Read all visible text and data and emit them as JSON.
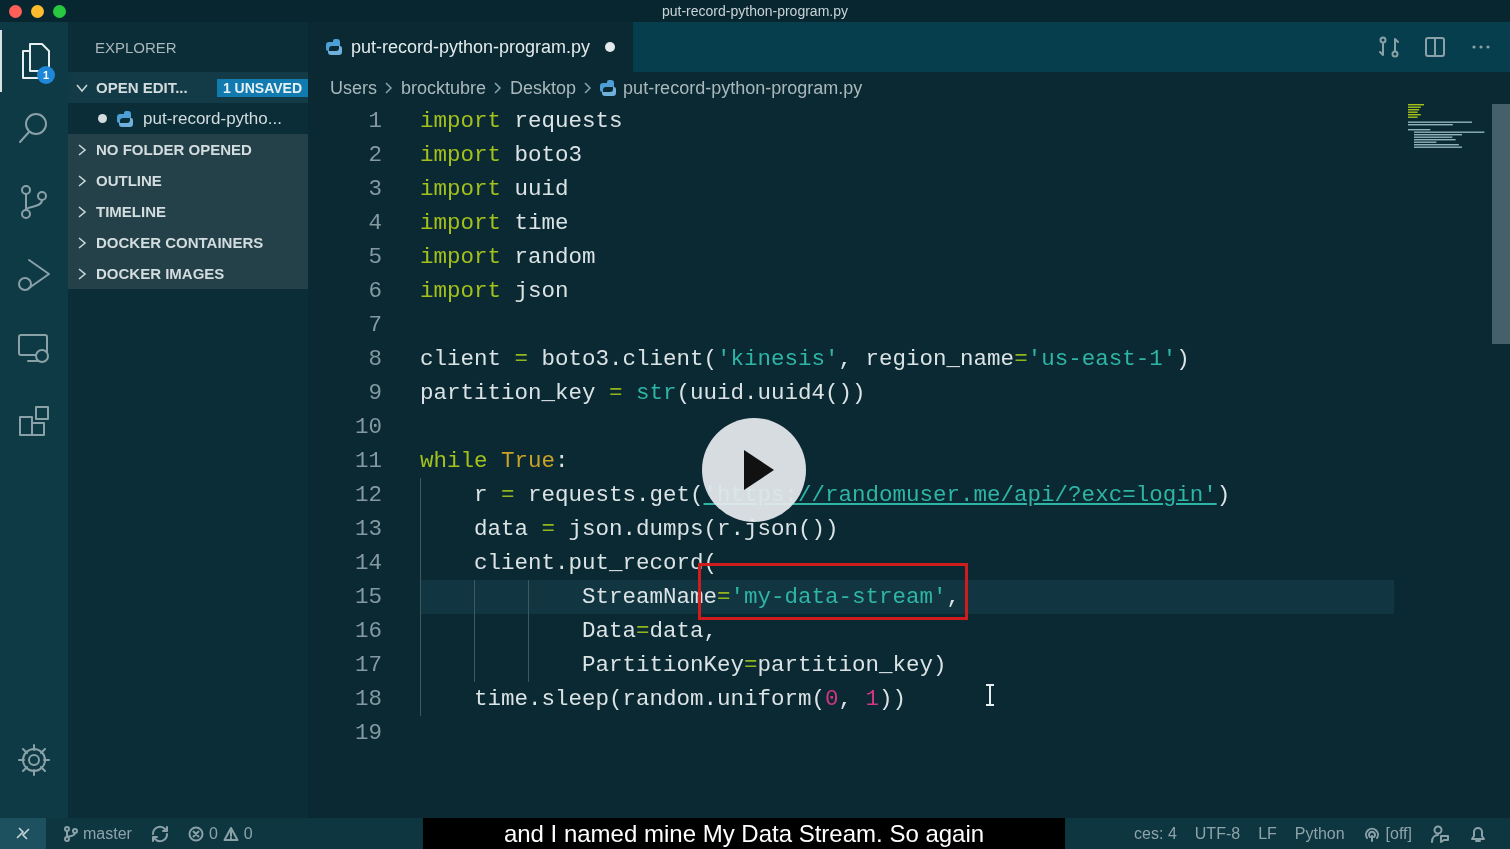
{
  "window": {
    "title": "put-record-python-program.py"
  },
  "activity_bar": {
    "explorer_badge": "1"
  },
  "sidebar": {
    "title": "EXPLORER",
    "open_editors": {
      "label": "OPEN EDIT...",
      "badge": "1 UNSAVED",
      "expanded": true,
      "items": [
        {
          "label": "put-record-pytho...",
          "modified": true
        }
      ]
    },
    "sections": [
      {
        "label": "NO FOLDER OPENED",
        "expanded": false
      },
      {
        "label": "OUTLINE",
        "expanded": false
      },
      {
        "label": "TIMELINE",
        "expanded": false
      },
      {
        "label": "DOCKER CONTAINERS",
        "expanded": false
      },
      {
        "label": "DOCKER IMAGES",
        "expanded": false
      }
    ]
  },
  "tabs": [
    {
      "label": "put-record-python-program.py",
      "modified": true,
      "selected": true
    }
  ],
  "breadcrumbs": [
    "Users",
    "brocktubre",
    "Desktop",
    "put-record-python-program.py"
  ],
  "code": [
    {
      "number": "1",
      "current": false,
      "tokens": [
        {
          "text": "import",
          "kind": "keyword"
        },
        {
          "text": " requests",
          "kind": "plain"
        }
      ]
    },
    {
      "number": "2",
      "current": false,
      "tokens": [
        {
          "text": "import",
          "kind": "keyword"
        },
        {
          "text": " boto3",
          "kind": "plain"
        }
      ]
    },
    {
      "number": "3",
      "current": false,
      "tokens": [
        {
          "text": "import",
          "kind": "keyword"
        },
        {
          "text": " uuid",
          "kind": "plain"
        }
      ]
    },
    {
      "number": "4",
      "current": false,
      "tokens": [
        {
          "text": "import",
          "kind": "keyword"
        },
        {
          "text": " time",
          "kind": "plain"
        }
      ]
    },
    {
      "number": "5",
      "current": false,
      "tokens": [
        {
          "text": "import",
          "kind": "keyword"
        },
        {
          "text": " random",
          "kind": "plain"
        }
      ]
    },
    {
      "number": "6",
      "current": false,
      "tokens": [
        {
          "text": "import",
          "kind": "keyword"
        },
        {
          "text": " json",
          "kind": "plain"
        }
      ]
    },
    {
      "number": "7",
      "current": false
    },
    {
      "number": "8",
      "current": false,
      "tokens": [
        {
          "text": "client ",
          "kind": "plain"
        },
        {
          "text": "=",
          "kind": "operator"
        },
        {
          "text": " boto3.client(",
          "kind": "plain"
        },
        {
          "text": "'kinesis'",
          "kind": "string"
        },
        {
          "text": ", region_name",
          "kind": "plain"
        },
        {
          "text": "=",
          "kind": "operator"
        },
        {
          "text": "'us-east-1'",
          "kind": "string"
        },
        {
          "text": ")",
          "kind": "plain"
        }
      ]
    },
    {
      "number": "9",
      "current": false,
      "tokens": [
        {
          "text": "partition_key",
          "kind": "plain"
        },
        {
          "text": " = ",
          "kind": "operator"
        },
        {
          "text": "str",
          "kind": "builtin"
        },
        {
          "text": "(uuid.uuid4())",
          "kind": "plain"
        }
      ]
    },
    {
      "number": "10",
      "current": false
    },
    {
      "number": "11",
      "current": false,
      "tokens": [
        {
          "text": "while ",
          "kind": "keyword"
        },
        {
          "text": "True",
          "kind": "constant"
        },
        {
          "text": ":",
          "kind": "plain"
        }
      ]
    },
    {
      "number": "12",
      "current": false,
      "tokens": [
        {
          "text": "    r ",
          "kind": "plain"
        },
        {
          "text": "=",
          "kind": "operator"
        },
        {
          "text": " requests.get(",
          "kind": "plain"
        },
        {
          "text": "'https://randomuser.me/api/?exc=login'",
          "kind": "link"
        },
        {
          "text": ")",
          "kind": "plain"
        }
      ]
    },
    {
      "number": "13",
      "current": false,
      "tokens": [
        {
          "text": "    data ",
          "kind": "plain"
        },
        {
          "text": "=",
          "kind": "operator"
        },
        {
          "text": " json.dumps(r.json())",
          "kind": "plain"
        }
      ]
    },
    {
      "number": "14",
      "current": false,
      "tokens": [
        {
          "text": "    client.put_record(",
          "kind": "plain"
        }
      ]
    },
    {
      "number": "15",
      "current": true,
      "tokens": [
        {
          "text": "            StreamName",
          "kind": "plain"
        },
        {
          "text": "=",
          "kind": "operator"
        },
        {
          "text": "'my-data-stream'",
          "kind": "string"
        },
        {
          "text": ",",
          "kind": "plain"
        }
      ]
    },
    {
      "number": "16",
      "current": false,
      "tokens": [
        {
          "text": "            Data",
          "kind": "plain"
        },
        {
          "text": "=",
          "kind": "operator"
        },
        {
          "text": "data,",
          "kind": "plain"
        }
      ]
    },
    {
      "number": "17",
      "current": false,
      "tokens": [
        {
          "text": "            PartitionKey",
          "kind": "plain"
        },
        {
          "text": "=",
          "kind": "operator"
        },
        {
          "text": "partition_key)",
          "kind": "plain"
        }
      ]
    },
    {
      "number": "18",
      "current": false,
      "tokens": [
        {
          "text": "    time.sleep(random.uniform(",
          "kind": "plain"
        },
        {
          "text": "0",
          "kind": "number"
        },
        {
          "text": ", ",
          "kind": "plain"
        },
        {
          "text": "1",
          "kind": "number"
        },
        {
          "text": "))",
          "kind": "plain"
        }
      ]
    },
    {
      "number": "19",
      "current": false
    }
  ],
  "status_bar": {
    "branch": "master",
    "errors": "0",
    "warnings": "0",
    "right": [
      "ces: 4",
      "UTF-8",
      "LF",
      "Python"
    ],
    "live_share": "[off]"
  },
  "video_overlay": {
    "subtitle": "and I named mine My Data Stream. So again"
  }
}
